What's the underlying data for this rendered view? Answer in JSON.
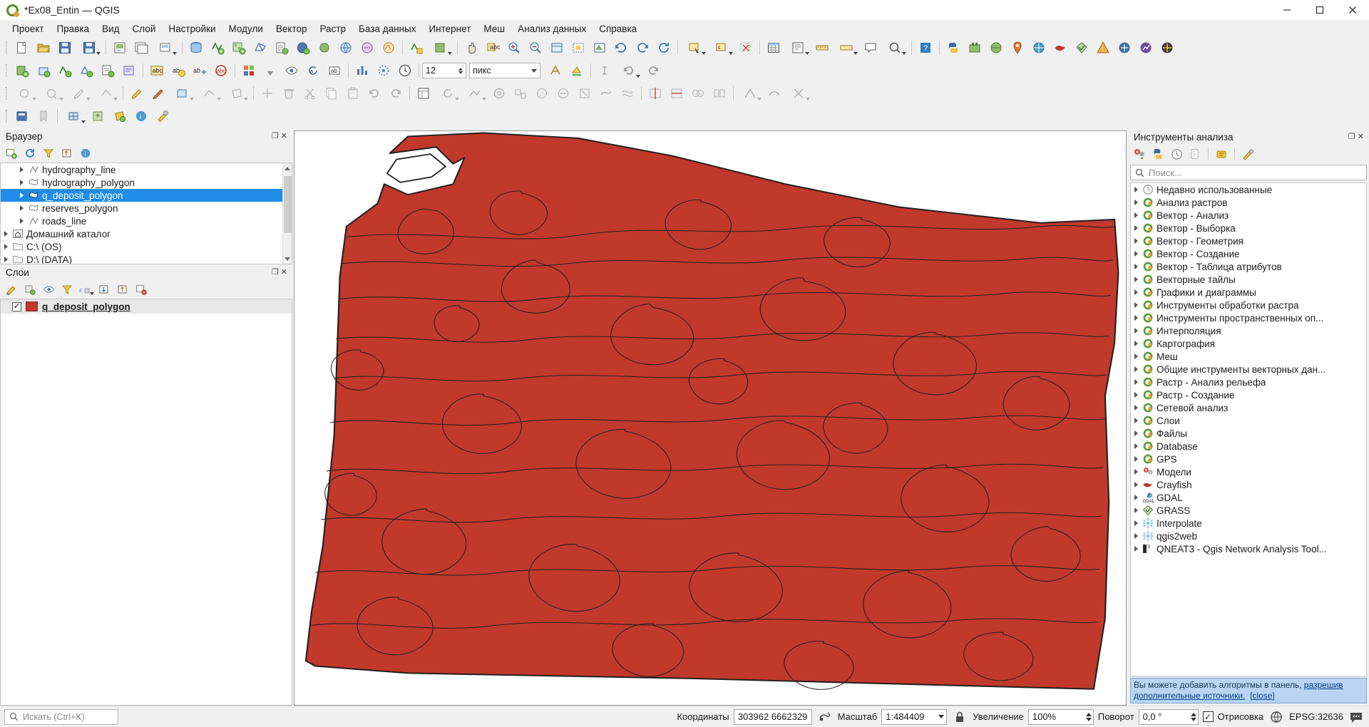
{
  "window": {
    "title": "*Ex08_Entin — QGIS",
    "logo_icon": "qgis-logo-icon",
    "minimize_label": "—",
    "maximize_label": "❐",
    "close_label": "✕"
  },
  "menubar": {
    "items": [
      {
        "label": "Проект"
      },
      {
        "label": "Правка"
      },
      {
        "label": "Вид"
      },
      {
        "label": "Слой"
      },
      {
        "label": "Настройки"
      },
      {
        "label": "Модули"
      },
      {
        "label": "Вектор"
      },
      {
        "label": "Растр"
      },
      {
        "label": "База данных"
      },
      {
        "label": "Интернет"
      },
      {
        "label": "Меш"
      },
      {
        "label": "Анализ данных"
      },
      {
        "label": "Справка"
      }
    ]
  },
  "toolbar_digitizing": {
    "size_value": "12",
    "units_value": "пикс"
  },
  "browser_panel": {
    "title": "Браузер",
    "tools": [
      "add-layer-icon",
      "refresh-icon",
      "filter-icon",
      "collapse-all-icon",
      "properties-icon"
    ],
    "items": [
      {
        "label": "hydrography_line",
        "icon": "vector-line-icon",
        "indent": 1,
        "selected": false
      },
      {
        "label": "hydrography_polygon",
        "icon": "vector-polygon-icon",
        "indent": 1,
        "selected": false
      },
      {
        "label": "q_deposit_polygon",
        "icon": "vector-polygon-icon",
        "indent": 1,
        "selected": true
      },
      {
        "label": "reserves_polygon",
        "icon": "vector-polygon-icon",
        "indent": 1,
        "selected": false
      },
      {
        "label": "roads_line",
        "icon": "vector-line-icon",
        "indent": 1,
        "selected": false
      },
      {
        "label": "Домашний каталог",
        "icon": "home-folder-icon",
        "indent": 0,
        "selected": false
      },
      {
        "label": "C:\\ (OS)",
        "icon": "folder-icon",
        "indent": 0,
        "selected": false
      },
      {
        "label": "D:\\ (DATA)",
        "icon": "folder-icon",
        "indent": 0,
        "selected": false
      }
    ]
  },
  "layers_panel": {
    "title": "Слои",
    "tools": [
      "open-layer-styling-icon",
      "add-group-icon",
      "manage-visibility-icon",
      "filter-legend-icon",
      "expression-filter-icon",
      "expand-all-icon",
      "collapse-all-icon",
      "remove-layer-icon"
    ],
    "layers": [
      {
        "name": "q_deposit_polygon",
        "checked": true,
        "swatch_color": "#c0392b"
      }
    ]
  },
  "toolbox_panel": {
    "title": "Инструменты анализа",
    "tools": [
      "models-icon",
      "python-console-icon",
      "history-icon",
      "results-viewer-icon",
      "edit-model-icon",
      "options-icon"
    ],
    "search": {
      "placeholder": "Поиск...",
      "value": "",
      "icon": "search-icon"
    },
    "items": [
      {
        "label": "Недавно использованные",
        "icon": "clock-icon"
      },
      {
        "label": "Анализ растров",
        "icon": "qgis-provider-icon"
      },
      {
        "label": "Вектор - Анализ",
        "icon": "qgis-provider-icon"
      },
      {
        "label": "Вектор - Выборка",
        "icon": "qgis-provider-icon"
      },
      {
        "label": "Вектор - Геометрия",
        "icon": "qgis-provider-icon"
      },
      {
        "label": "Вектор - Создание",
        "icon": "qgis-provider-icon"
      },
      {
        "label": "Вектор - Таблица атрибутов",
        "icon": "qgis-provider-icon"
      },
      {
        "label": "Векторные тайлы",
        "icon": "qgis-provider-icon"
      },
      {
        "label": "Графики и диаграммы",
        "icon": "qgis-provider-icon"
      },
      {
        "label": "Инструменты обработки растра",
        "icon": "qgis-provider-icon"
      },
      {
        "label": "Инструменты пространственных оп...",
        "icon": "qgis-provider-icon"
      },
      {
        "label": "Интерполяция",
        "icon": "qgis-provider-icon"
      },
      {
        "label": "Картография",
        "icon": "qgis-provider-icon"
      },
      {
        "label": "Меш",
        "icon": "qgis-provider-icon"
      },
      {
        "label": "Общие инструменты векторных дан...",
        "icon": "qgis-provider-icon"
      },
      {
        "label": "Растр - Анализ рельефа",
        "icon": "qgis-provider-icon"
      },
      {
        "label": "Растр - Создание",
        "icon": "qgis-provider-icon"
      },
      {
        "label": "Сетевой анализ",
        "icon": "qgis-provider-icon"
      },
      {
        "label": "Слои",
        "icon": "qgis-provider-icon"
      },
      {
        "label": "Файлы",
        "icon": "qgis-provider-icon"
      },
      {
        "label": "Database",
        "icon": "qgis-provider-icon"
      },
      {
        "label": "GPS",
        "icon": "qgis-provider-icon"
      },
      {
        "label": "Модели",
        "icon": "models-provider-icon"
      },
      {
        "label": "Crayfish",
        "icon": "crayfish-icon"
      },
      {
        "label": "GDAL",
        "icon": "gdal-icon"
      },
      {
        "label": "GRASS",
        "icon": "grass-icon"
      },
      {
        "label": "Interpolate",
        "icon": "interpolate-icon"
      },
      {
        "label": "qgis2web",
        "icon": "qgis2web-icon"
      },
      {
        "label": "QNEAT3 - Qgis Network Analysis Tool...",
        "icon": "qneat3-icon"
      }
    ],
    "notice": {
      "text_before": "Вы можете добавить алгоритмы в панель, ",
      "link1": "разрешив дополнительные источники.",
      "link2": "[close]"
    }
  },
  "map": {
    "layer_fill_color": "#c0392b",
    "layer_stroke_color": "#231f20",
    "background_color": "#ffffff"
  },
  "statusbar": {
    "locator": {
      "placeholder": "Искать (Ctrl+K)",
      "icon": "search-icon"
    },
    "coordinates_label": "Координаты",
    "coordinates_value": "303962  6662329",
    "extent_toggle_icon": "toggle-extents-icon",
    "scale_label": "Масштаб",
    "scale_value": "1:484409",
    "lock_icon": "lock-scale-icon",
    "magnifier_label": "Увеличение",
    "magnifier_value": "100%",
    "rotation_label": "Поворот",
    "rotation_value": "0,0 °",
    "render_label": "Отрисовка",
    "render_checked": true,
    "crs_icon": "crs-globe-icon",
    "crs_value": "EPSG:32636",
    "messages_icon": "messages-icon"
  }
}
